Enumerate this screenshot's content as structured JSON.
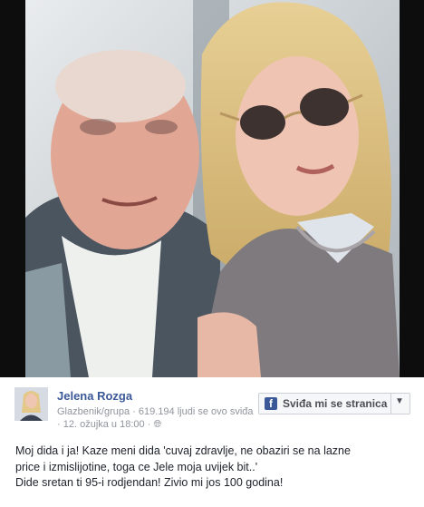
{
  "page": {
    "name": "Jelena Rozga",
    "category": "Glazbenik/grupa",
    "likes_text": "619.194 ljudi se ovo sviđa",
    "date": "12. ožujka u 18:00",
    "globe_icon": "globe-icon"
  },
  "like_button": {
    "label": "Sviđa mi se stranica",
    "icon": "facebook-icon",
    "dropdown_icon": "chevron-down-icon"
  },
  "post": {
    "lines": [
      "Moj dida i ja! Kaze meni dida 'cuvaj zdravlje, ne obaziri se na lazne",
      "price i izmislijotine, toga ce Jele moja uvijek bit..'",
      "Dide sretan ti 95-i rodjendan! Zivio mi jos 100 godina!"
    ]
  },
  "colors": {
    "link": "#3b5998",
    "meta": "#90949c",
    "text": "#1d2129"
  }
}
